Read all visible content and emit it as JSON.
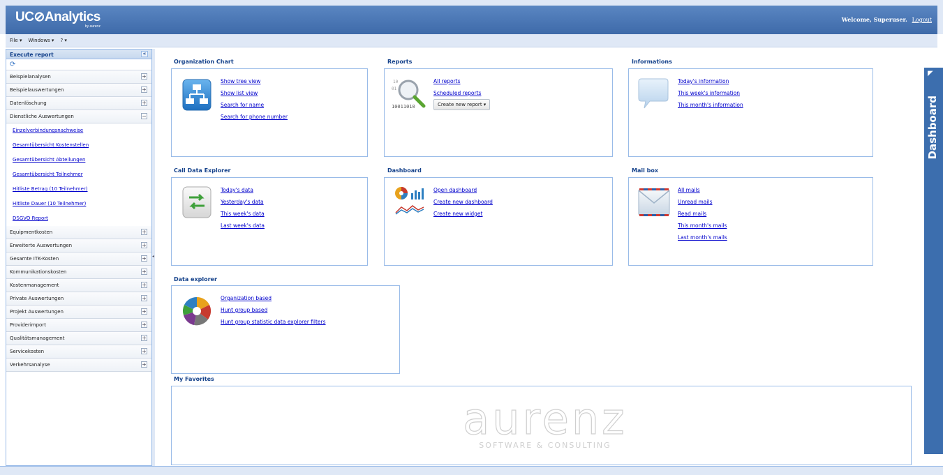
{
  "app": {
    "logo": "UC⊘Analytics",
    "logo_sub": "by aurenz",
    "welcome": "Welcome, Superuser.",
    "logout": "Logout"
  },
  "menu": {
    "file": "File ▾",
    "windows": "Windows ▾",
    "help": "? ▾"
  },
  "sidebar": {
    "title": "Execute report",
    "collapse_symbol": "«",
    "refresh_symbol": "⟳",
    "groups_top": [
      {
        "label": "Beispielanalysen",
        "toggle": "+"
      },
      {
        "label": "Beispielauswertungen",
        "toggle": "+"
      },
      {
        "label": "Datenlöschung",
        "toggle": "+"
      },
      {
        "label": "Dienstliche Auswertungen",
        "toggle": "−"
      }
    ],
    "sub_items": [
      "Einzelverbindungsnachweise",
      "Gesamtübersicht Kostenstellen",
      "Gesamtübersicht Abteilungen",
      "Gesamtübersicht Teilnehmer",
      "Hitliste Betrag (10 Teilnehmer)",
      "Hitliste Dauer (10 Teilnehmer)",
      "DSGVO Report"
    ],
    "groups_bottom": [
      {
        "label": "Equipmentkosten",
        "toggle": "+"
      },
      {
        "label": "Erweiterte Auswertungen",
        "toggle": "+"
      },
      {
        "label": "Gesamte ITK-Kosten",
        "toggle": "+"
      },
      {
        "label": "Kommunikationskosten",
        "toggle": "+"
      },
      {
        "label": "Kostenmanagement",
        "toggle": "+"
      },
      {
        "label": "Private Auswertungen",
        "toggle": "+"
      },
      {
        "label": "Projekt Auswertungen",
        "toggle": "+"
      },
      {
        "label": "Providerimport",
        "toggle": "+"
      },
      {
        "label": "Qualitätsmanagement",
        "toggle": "+"
      },
      {
        "label": "Servicekosten",
        "toggle": "+"
      },
      {
        "label": "Verkehrsanalyse",
        "toggle": "+"
      }
    ]
  },
  "panels": {
    "org_chart": {
      "title": "Organization Chart",
      "links": [
        "Show tree view",
        "Show list view",
        "Search for name",
        "Search for phone number"
      ]
    },
    "reports": {
      "title": "Reports",
      "links": [
        "All reports",
        "Scheduled reports"
      ],
      "button": "Create new report ▾",
      "icon_text": "10011010"
    },
    "informations": {
      "title": "Informations",
      "links": [
        "Today's information",
        "This week's information",
        "This month's information"
      ]
    },
    "call_data": {
      "title": "Call Data Explorer",
      "links": [
        "Today's data",
        "Yesterday's data",
        "This week's data",
        "Last week's data"
      ]
    },
    "dashboard": {
      "title": "Dashboard",
      "links": [
        "Open dashboard",
        "Create new dashboard",
        "Create new widget"
      ]
    },
    "mailbox": {
      "title": "Mail box",
      "links": [
        "All mails",
        "Unread mails",
        "Read mails",
        "This month's mails",
        "Last month's mails"
      ]
    },
    "data_explorer": {
      "title": "Data explorer",
      "links": [
        "Organization based",
        "Hunt group based",
        "Hunt group statistic data explorer filters"
      ]
    },
    "favorites": {
      "title": "My Favorites",
      "watermark": "aurenz",
      "watermark_sub": "SOFTWARE & CONSULTING"
    }
  },
  "dashboard_tab": {
    "label": "Dashboard"
  },
  "colors": {
    "header": "#4a78b8",
    "link": "#0000cc",
    "title": "#15428b",
    "border": "#99bbe8"
  }
}
